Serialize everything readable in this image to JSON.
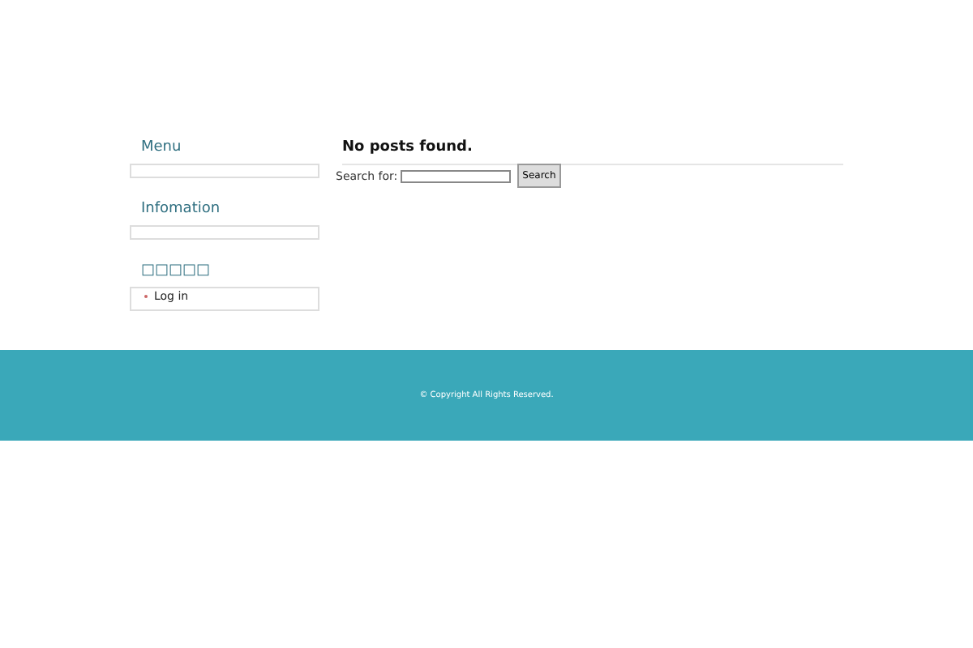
{
  "sidebar": {
    "widgets": [
      {
        "title": "Menu"
      },
      {
        "title": "Infomation"
      },
      {
        "title": "□□□□□",
        "items": [
          "Log in"
        ]
      }
    ]
  },
  "main": {
    "heading": "No posts found.",
    "search": {
      "label": "Search for:",
      "button": "Search"
    }
  },
  "footer": {
    "copyright": "© Copyright All Rights Reserved."
  }
}
